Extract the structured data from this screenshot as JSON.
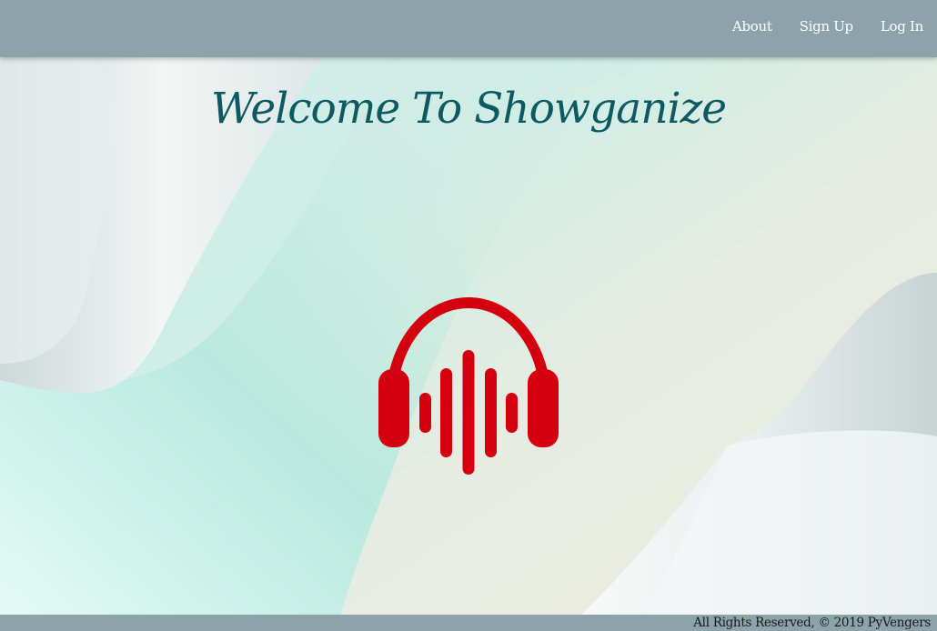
{
  "nav": {
    "links": [
      {
        "label": "About"
      },
      {
        "label": "Sign Up"
      },
      {
        "label": "Log In"
      }
    ]
  },
  "hero": {
    "title": "Welcome To Showganize",
    "logo_icon": "headphones-soundwave-icon",
    "logo_color": "#d4000f"
  },
  "footer": {
    "text": "All Rights Reserved, © 2019 PyVengers"
  },
  "colors": {
    "navbar": "#8da3aa",
    "title": "#0e5a62"
  }
}
